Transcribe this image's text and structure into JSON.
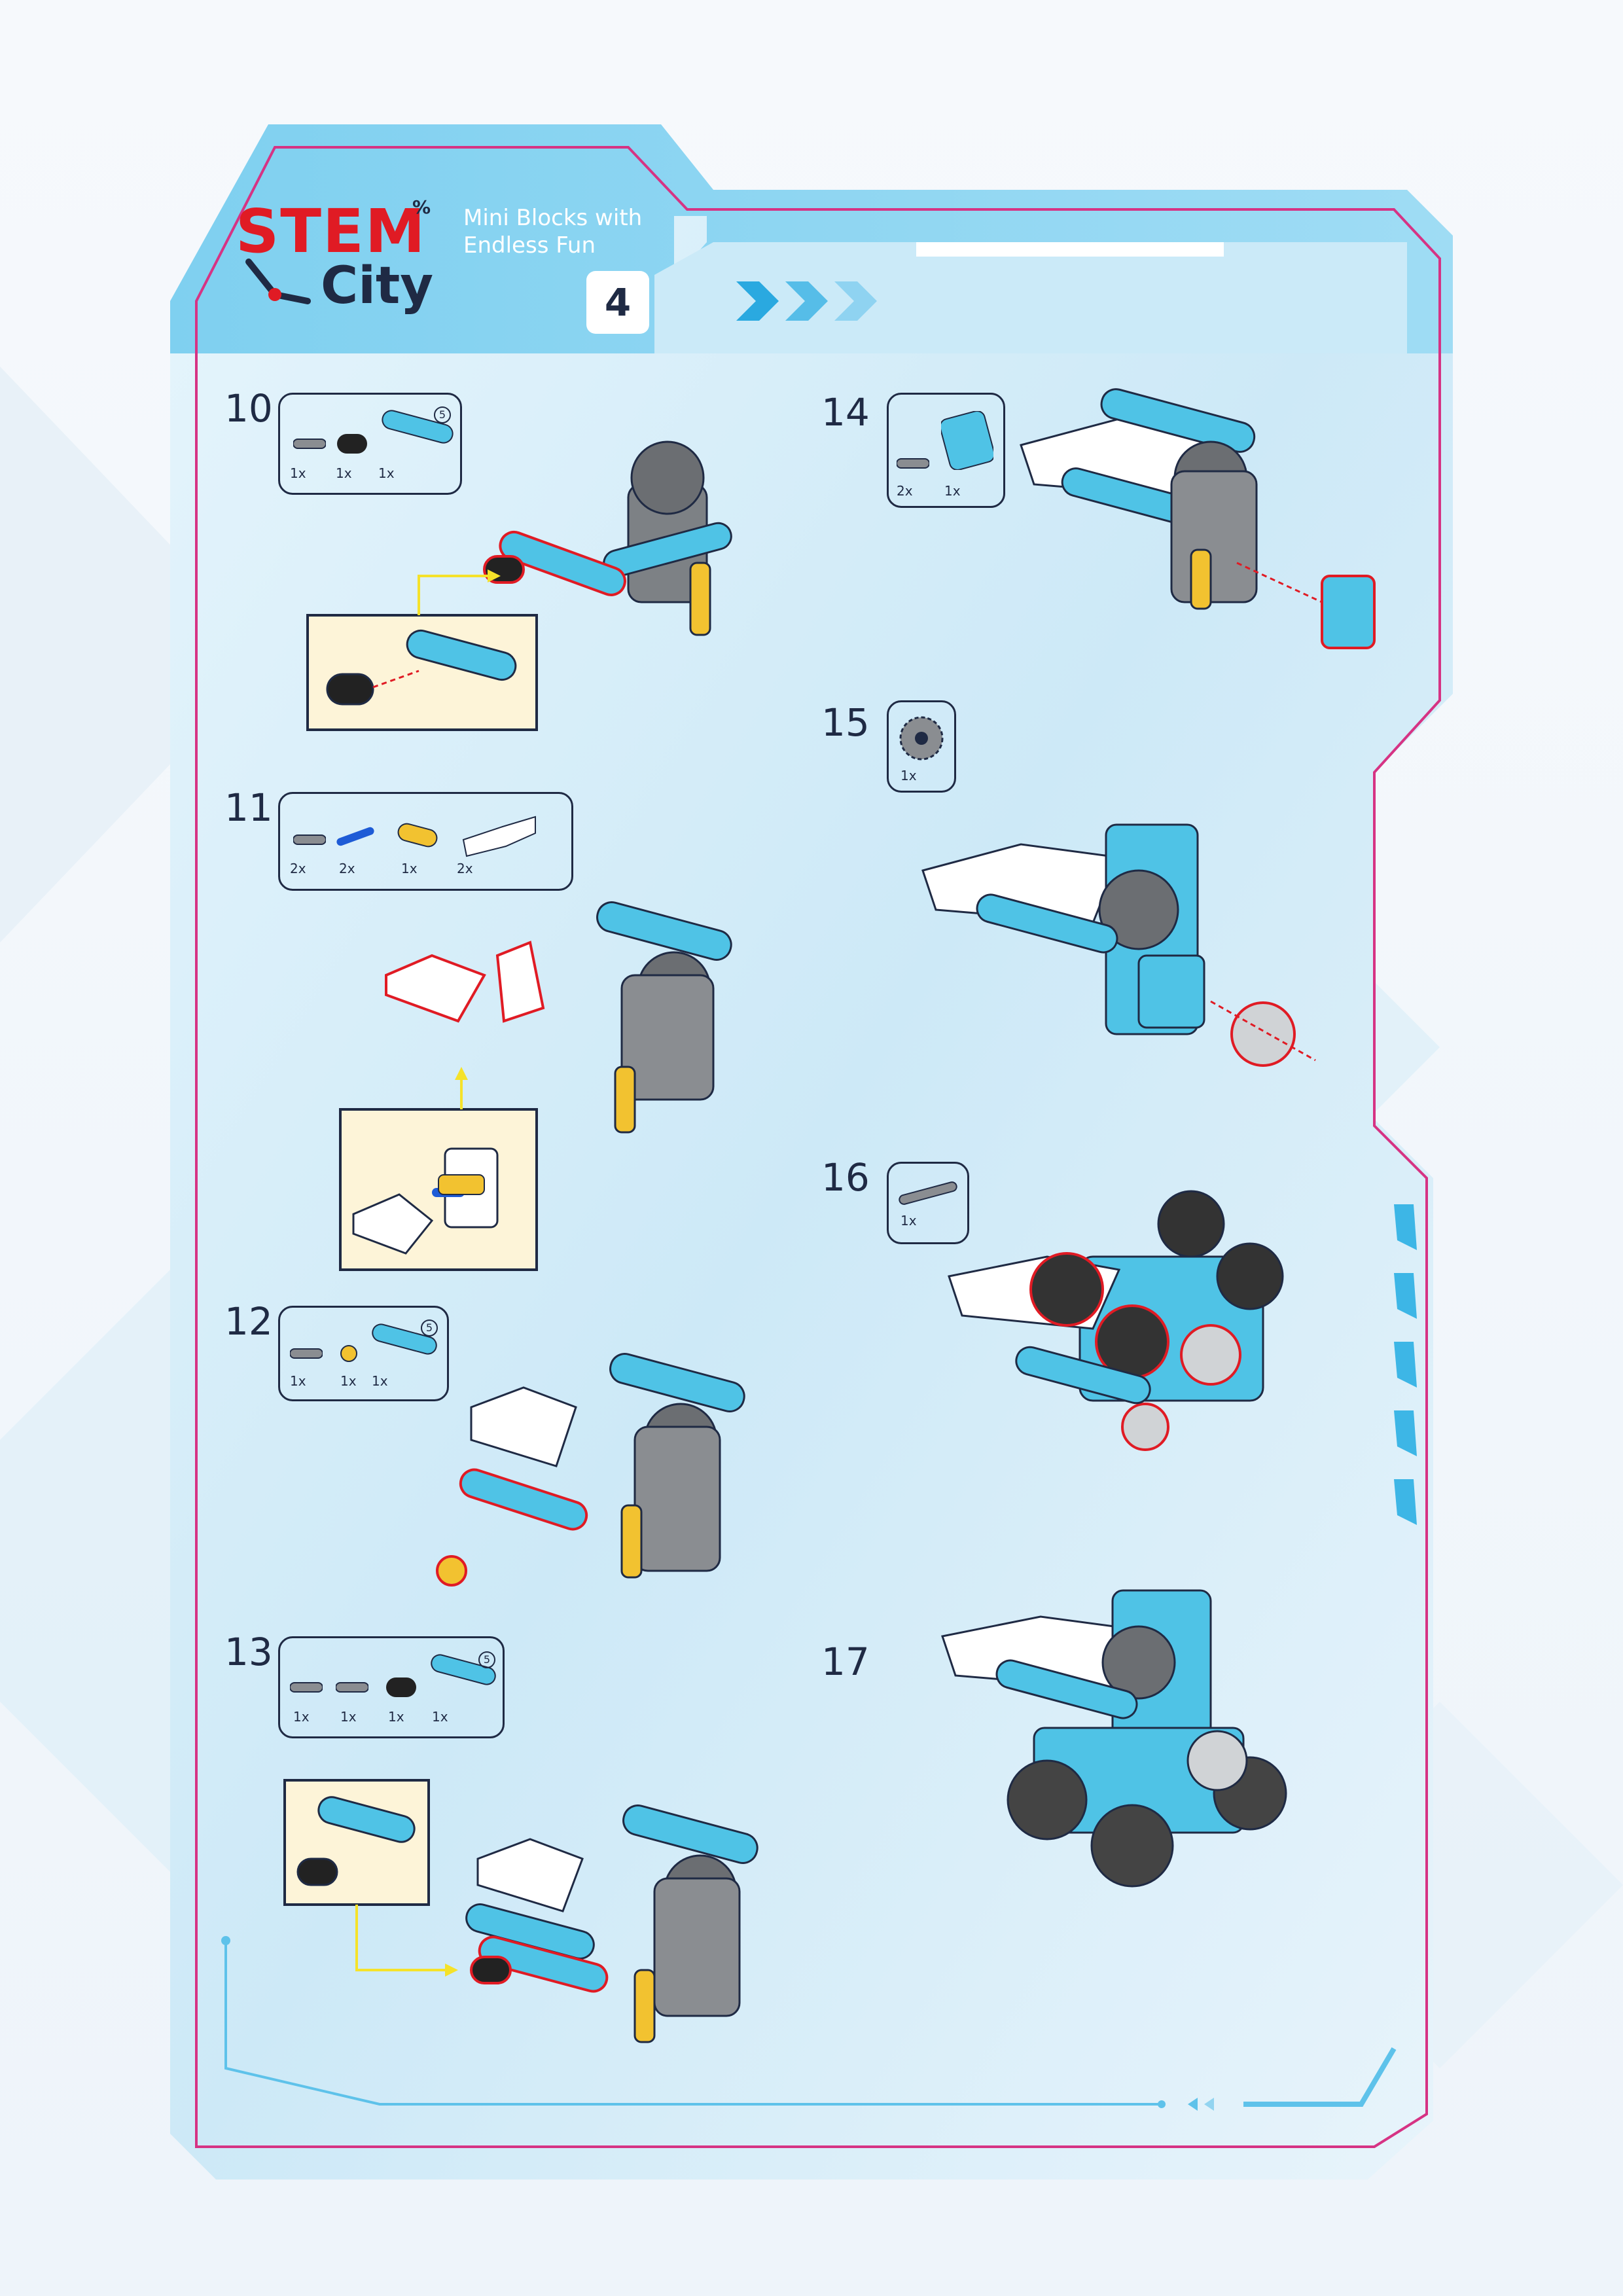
{
  "header": {
    "logo_stem": "STEM",
    "logo_city": "City",
    "logo_percent": "%",
    "tagline_line1": "Mini Blocks with",
    "tagline_line2": "Endless Fun",
    "page_number": "4"
  },
  "steps": [
    {
      "number": "10",
      "parts": [
        {
          "qty": "1x"
        },
        {
          "qty": "1x"
        },
        {
          "qty": "1x"
        }
      ],
      "beam_length": "5"
    },
    {
      "number": "11",
      "parts": [
        {
          "qty": "2x"
        },
        {
          "qty": "2x"
        },
        {
          "qty": "1x"
        },
        {
          "qty": "2x"
        }
      ]
    },
    {
      "number": "12",
      "parts": [
        {
          "qty": "1x"
        },
        {
          "qty": "1x"
        },
        {
          "qty": "1x"
        }
      ],
      "beam_length": "5"
    },
    {
      "number": "13",
      "parts": [
        {
          "qty": "1x"
        },
        {
          "qty": "1x"
        },
        {
          "qty": "1x"
        },
        {
          "qty": "1x"
        }
      ],
      "beam_length": "5"
    },
    {
      "number": "14",
      "parts": [
        {
          "qty": "2x"
        },
        {
          "qty": "1x"
        }
      ]
    },
    {
      "number": "15",
      "parts": [
        {
          "qty": "1x"
        }
      ]
    },
    {
      "number": "16",
      "parts": [
        {
          "qty": "1x"
        }
      ]
    },
    {
      "number": "17",
      "parts": []
    }
  ],
  "colors": {
    "brand_blue": "#5ec2ea",
    "light_blue": "#bfe6f8",
    "accent_red": "#e01b24",
    "dark_navy": "#1f2a44",
    "frame_pink": "#d63384",
    "part_cyan": "#4fc3e6",
    "part_yellow": "#f2c230",
    "part_gray": "#8a8d91",
    "callout_bg": "#fdf4d8"
  }
}
